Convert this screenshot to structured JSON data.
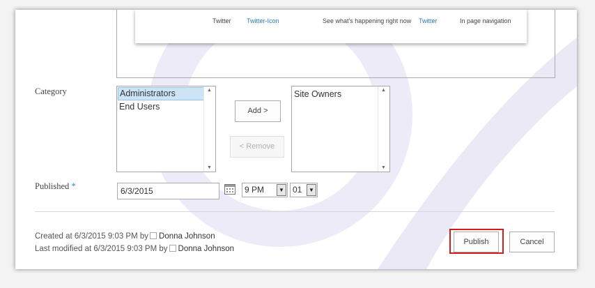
{
  "preview_card": {
    "col1": "Twitter",
    "col2": "Twitter-Icon",
    "col3": "See what's happening right now",
    "col4": "Twitter",
    "col5": "In page navigation"
  },
  "category": {
    "label": "Category",
    "available_items": [
      "Administrators",
      "End Users"
    ],
    "selected_available": "Administrators",
    "chosen_items": [
      "Site Owners"
    ],
    "add_button": "Add >",
    "remove_button": "< Remove"
  },
  "published": {
    "label": "Published",
    "required_mark": "*",
    "date_value": "6/3/2015",
    "hour_value": "9 PM",
    "minute_value": "01"
  },
  "footer": {
    "created_prefix": "Created at 6/3/2015 9:03 PM  by",
    "created_by": "Donna Johnson",
    "modified_prefix": "Last modified at 6/3/2015 9:03 PM  by",
    "modified_by": "Donna Johnson",
    "publish_button": "Publish",
    "cancel_button": "Cancel"
  },
  "colors": {
    "accent_link": "#2a7ab8",
    "required_star": "#2a8dd4",
    "publish_highlight": "#d11c1c",
    "decor_lavender": "#ece9f7"
  }
}
